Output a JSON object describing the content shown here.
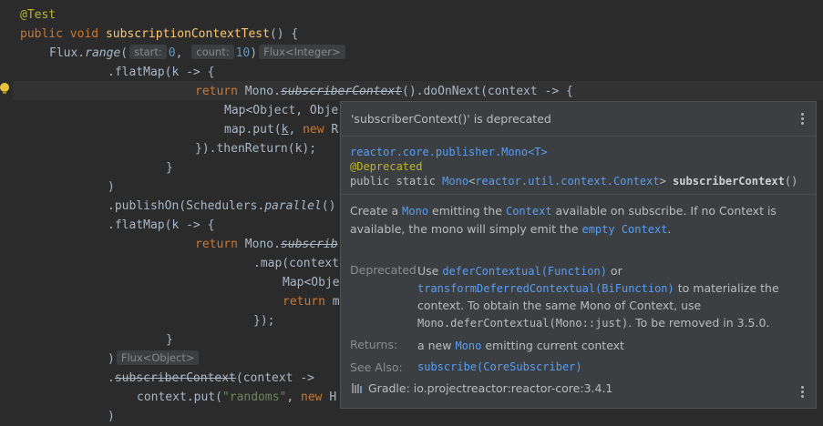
{
  "colors": {
    "background": "#2b2b2b",
    "keyword": "#cc7832",
    "annotation": "#bbb529",
    "method": "#ffc66d",
    "string": "#6a8759",
    "number": "#6897bb",
    "link": "#589df6",
    "popup_bg": "#3c3f41"
  },
  "code": {
    "l1": {
      "annotation": "@Test"
    },
    "l2": {
      "kw1": "public",
      "kw2": "void",
      "method": "subscriptionContextTest",
      "rest": "() {"
    },
    "l3": {
      "text1": "Flux.",
      "fn": "range",
      "paren": "(",
      "hint1": "start:",
      "num1": "0",
      "comma": ", ",
      "hint2": "count:",
      "num2": "10",
      "close": ")",
      "type_hint": "Flux<Integer>"
    },
    "l4": {
      "text": ".flatMap(k -> {"
    },
    "l5": {
      "kw": "return",
      "text1": " Mono.",
      "dep": "subscriberContext",
      "text2": "().doOnNext(context -> {"
    },
    "l6": {
      "text": "Map<Object, Obje"
    },
    "l7": {
      "text1": "map.put(",
      "k": "k",
      "text2": ", ",
      "kw": "new",
      "text3": " R"
    },
    "l8": {
      "text": "}).thenReturn(k);"
    },
    "l9": {
      "text": "}"
    },
    "l10": {
      "text": ")"
    },
    "l11": {
      "text1": ".publishOn(Schedulers.",
      "fn": "parallel",
      "text2": "()"
    },
    "l12": {
      "text": ".flatMap(k -> {"
    },
    "l13": {
      "kw": "return",
      "text1": " Mono.",
      "dep": "subscrib"
    },
    "l14": {
      "text": ".map(context"
    },
    "l15": {
      "text": "Map<Obje"
    },
    "l16": {
      "kw": "return",
      "text": " m"
    },
    "l17": {
      "text": "});"
    },
    "l18": {
      "text": "}"
    },
    "l19": {
      "text": ")",
      "type_hint": "Flux<Object>"
    },
    "l20": {
      "text1": ".",
      "dep": "subscriberContext",
      "text2": "(context ->"
    },
    "l21": {
      "text1": "context.put(",
      "str": "\"randoms\"",
      "text2": ", ",
      "kw": "new",
      "text3": " H"
    },
    "l22": {
      "text": ")"
    }
  },
  "popup": {
    "title": "'subscriberContext()' is deprecated",
    "signature": {
      "class": "reactor.core.publisher.Mono<T>",
      "annotation": "@Deprecated",
      "prefix": "public static ",
      "return_type1": "Mono",
      "return_type2": "<",
      "return_type3": "reactor.util.context.Context",
      "return_type4": ">",
      "name": " subscriberContext",
      "suffix": "()"
    },
    "description": {
      "p1": "Create a ",
      "mono": "Mono",
      "p2": " emitting the ",
      "context": "Context",
      "p3": " available on subscribe. If no Context is available, the mono will simply emit the ",
      "empty": "empty Context",
      "p4": "."
    },
    "deprecated": {
      "label": "Deprecated",
      "t1": "Use ",
      "link1": "deferContextual(Function)",
      "t2": " or",
      "link2": "transformDeferredContextual(BiFunction)",
      "t3": " to materialize the",
      "t4": "context. To obtain the same Mono of Context, use",
      "code": "Mono.deferContextual(Mono::just)",
      "t5": ". To be removed in 3.5.0."
    },
    "returns": {
      "label": "Returns:",
      "t1": "a new ",
      "mono": "Mono",
      "t2": " emitting current context"
    },
    "see_also": {
      "label": "See Also:",
      "link": "subscribe(CoreSubscriber)"
    },
    "gradle": {
      "icon": "gradle-library-icon",
      "text": "Gradle: io.projectreactor:reactor-core:3.4.1"
    },
    "menu_icon": "more-vertical-icon"
  }
}
